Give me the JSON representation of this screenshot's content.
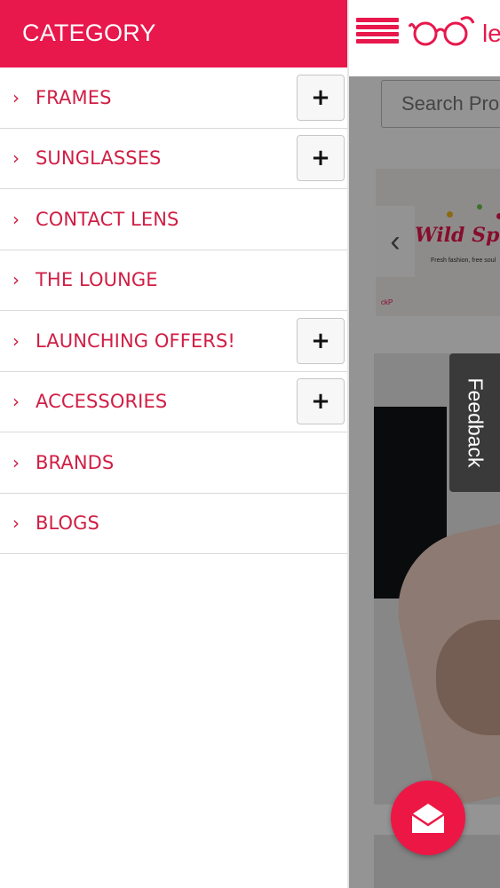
{
  "drawer": {
    "title": "CATEGORY",
    "items": [
      {
        "label": "FRAMES",
        "expandable": true
      },
      {
        "label": "SUNGLASSES",
        "expandable": true
      },
      {
        "label": "CONTACT LENS",
        "expandable": false
      },
      {
        "label": "THE LOUNGE",
        "expandable": false
      },
      {
        "label": "LAUNCHING OFFERS!",
        "expandable": true
      },
      {
        "label": "ACCESSORIES",
        "expandable": true
      },
      {
        "label": "BRANDS",
        "expandable": false
      },
      {
        "label": "BLOGS",
        "expandable": false
      }
    ],
    "chevron": "›",
    "expand_symbol": "+"
  },
  "header": {
    "logo_text": "le"
  },
  "search": {
    "placeholder": "Search Pro"
  },
  "banner": {
    "title": "Wild Spirit",
    "subtitle": "Fresh fashion, free soul",
    "mini_text": "ckP",
    "prev_arrow": "‹"
  },
  "feedback": {
    "label": "Feedback"
  },
  "colors": {
    "brand": "#e8174c",
    "overlay": "rgba(0,0,0,0.42)",
    "fab": "#ec1745"
  },
  "icons": {
    "menu": "hamburger-icon",
    "logo": "glasses-logo-icon",
    "mail": "mail-icon",
    "expand": "plus-icon",
    "chevron": "chevron-right-icon"
  }
}
